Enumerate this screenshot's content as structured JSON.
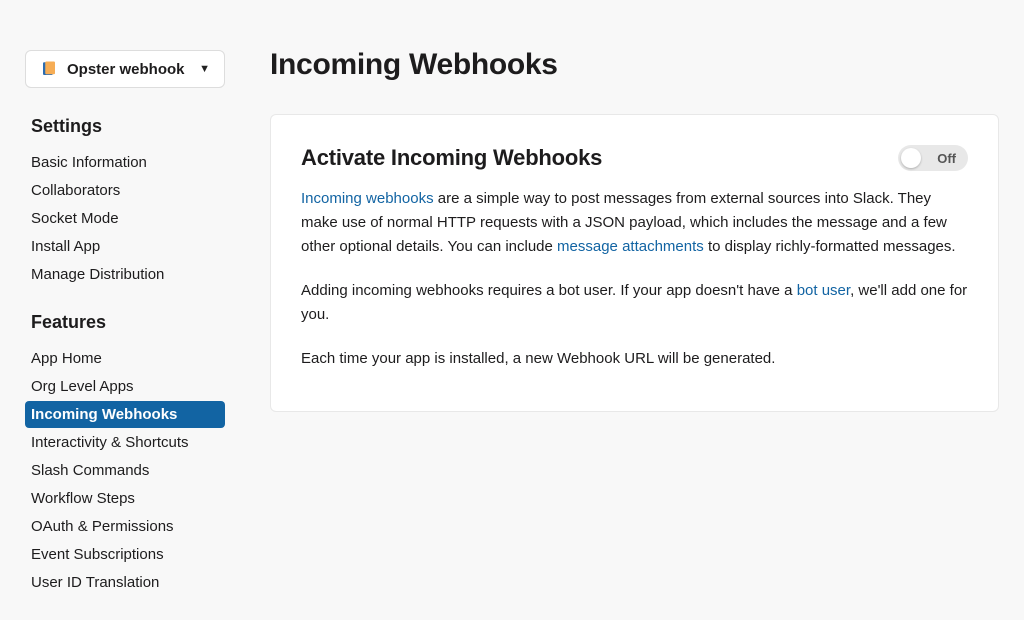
{
  "app_selector": {
    "name": "Opster webhook"
  },
  "sidebar": {
    "groups": [
      {
        "heading": "Settings",
        "items": [
          {
            "label": "Basic Information",
            "active": false
          },
          {
            "label": "Collaborators",
            "active": false
          },
          {
            "label": "Socket Mode",
            "active": false
          },
          {
            "label": "Install App",
            "active": false
          },
          {
            "label": "Manage Distribution",
            "active": false
          }
        ]
      },
      {
        "heading": "Features",
        "items": [
          {
            "label": "App Home",
            "active": false
          },
          {
            "label": "Org Level Apps",
            "active": false
          },
          {
            "label": "Incoming Webhooks",
            "active": true
          },
          {
            "label": "Interactivity & Shortcuts",
            "active": false
          },
          {
            "label": "Slash Commands",
            "active": false
          },
          {
            "label": "Workflow Steps",
            "active": false
          },
          {
            "label": "OAuth & Permissions",
            "active": false
          },
          {
            "label": "Event Subscriptions",
            "active": false
          },
          {
            "label": "User ID Translation",
            "active": false
          }
        ]
      }
    ]
  },
  "page": {
    "title": "Incoming Webhooks"
  },
  "card": {
    "title": "Activate Incoming Webhooks",
    "toggle_state": "Off",
    "p1_link1": "Incoming webhooks",
    "p1_text1": " are a simple way to post messages from external sources into Slack. They make use of normal HTTP requests with a JSON payload, which includes the message and a few other optional details. You can include ",
    "p1_link2": "message attachments",
    "p1_text2": " to display richly-formatted messages.",
    "p2_text1": "Adding incoming webhooks requires a bot user. If your app doesn't have a ",
    "p2_link1": "bot user",
    "p2_text2": ", we'll add one for you.",
    "p3_text": "Each time your app is installed, a new Webhook URL will be generated."
  }
}
